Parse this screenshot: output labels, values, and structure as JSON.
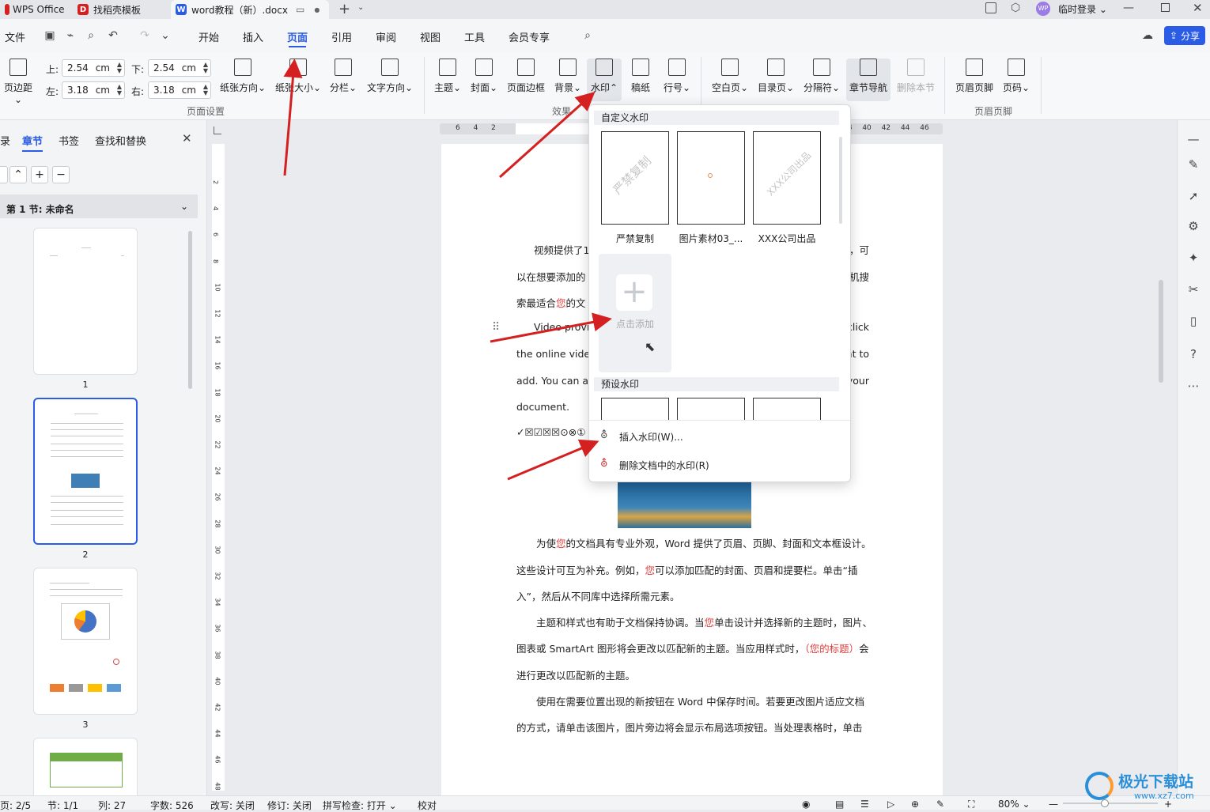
{
  "titlebar": {
    "tabs": [
      {
        "label": "WPS Office"
      },
      {
        "label": "找稻壳模板"
      },
      {
        "label": "word教程（新）.docx"
      }
    ],
    "user": "临时登录"
  },
  "menubar": {
    "file": "文件",
    "items": [
      "开始",
      "插入",
      "页面",
      "引用",
      "审阅",
      "视图",
      "工具",
      "会员专享"
    ],
    "active": "页面",
    "share": "分享"
  },
  "ribbon": {
    "margins_label": "页边距",
    "top_label": "上:",
    "top_value": "2.54",
    "bottom_label": "下:",
    "bottom_value": "2.54",
    "left_label": "左:",
    "left_value": "3.18",
    "right_label": "右:",
    "right_value": "3.18",
    "unit": "cm",
    "orientation": "纸张方向",
    "size": "纸张大小",
    "columns": "分栏",
    "text_direction": "文字方向",
    "page_setup_group": "页面设置",
    "theme": "主题",
    "cover": "封面",
    "page_border": "页面边框",
    "background": "背景",
    "watermark": "水印",
    "manuscript": "稿纸",
    "line_number": "行号",
    "effects_group": "效果",
    "blank_page": "空白页",
    "toc_page": "目录页",
    "separator": "分隔符",
    "section_nav": "章节导航",
    "delete_section": "删除本节",
    "header_footer": "页眉页脚",
    "page_number": "页码",
    "header_footer_group": "页眉页脚"
  },
  "leftpanel": {
    "tabs": [
      "录",
      "章节",
      "书签",
      "查找和替换"
    ],
    "active": "章节",
    "section": "第 1 节: 未命名",
    "pages": [
      "1",
      "2",
      "3"
    ]
  },
  "document": {
    "lines": [
      {
        "segments": [
          {
            "t": "视频提供了1"
          }
        ],
        "tail": "，可"
      },
      {
        "segments": [
          {
            "t": "以在想要添加的"
          }
        ],
        "tail": "机搜"
      },
      {
        "segments": [
          {
            "t": "索最适合"
          },
          {
            "t": "您",
            "red": true
          },
          {
            "t": "的文"
          }
        ],
        "tail": ""
      },
      {
        "segments": [
          {
            "t": "Video provid"
          }
        ],
        "tail": "click"
      },
      {
        "segments": [
          {
            "t": "the online video,"
          }
        ],
        "tail": "nt to"
      },
      {
        "segments": [
          {
            "t": "add. You can als"
          }
        ],
        "tail": "your"
      },
      {
        "segments": [
          {
            "t": "document."
          }
        ],
        "tail": ""
      },
      {
        "segments": [
          {
            "t": "✓☒☑☒☒⊙⊗①"
          }
        ],
        "tail": ""
      }
    ],
    "paragraphs": [
      [
        {
          "t": "　　为使"
        },
        {
          "t": "您",
          "red": true
        },
        {
          "t": "的文档具有专业外观，Word 提供了页眉、页脚、封面和文本框设计。"
        }
      ],
      [
        {
          "t": "这些设计可互为补充。例如，"
        },
        {
          "t": "您",
          "red": true
        },
        {
          "t": "可以添加匹配的封面、页眉和提要栏。单击“插"
        }
      ],
      [
        {
          "t": "入”，然后从不同库中选择所需元素。"
        }
      ],
      [
        {
          "t": "　　主题和样式也有助于文档保持协调。当"
        },
        {
          "t": "您",
          "red": true
        },
        {
          "t": "单击设计并选择新的主题时，图片、"
        }
      ],
      [
        {
          "t": "图表或 SmartArt 图形将会更改以匹配新的主题。当应用样式时，"
        },
        {
          "t": "（您的标题）",
          "red": true
        },
        {
          "t": "会"
        }
      ],
      [
        {
          "t": "进行更改以匹配新的主题。"
        }
      ],
      [
        {
          "t": "　　使用在需要位置出现的新按钮在 Word 中保存时间。若要更改图片适应文档"
        }
      ],
      [
        {
          "t": "的方式，请单击该图片，图片旁边将会显示布局选项按钮。当处理表格时，单击"
        }
      ]
    ]
  },
  "dropdown": {
    "custom_header": "自定义水印",
    "cards": [
      {
        "label": "严禁复制",
        "text": "严禁复制"
      },
      {
        "label": "图片素材03_...",
        "text": ""
      },
      {
        "label": "XXX公司出品",
        "text": "XXX公司出品"
      }
    ],
    "add_label": "点击添加",
    "preset_header": "预设水印",
    "insert": "插入水印(W)...",
    "delete": "删除文档中的水印(R)"
  },
  "statusbar": {
    "page": "页: 2/5",
    "section": "节: 1/1",
    "column": "列: 27",
    "words": "字数: 526",
    "rewrite": "改写: 关闭",
    "revision": "修订: 关闭",
    "spell": "拼写检查: 打开",
    "proof": "校对",
    "zoom": "80%"
  },
  "watermark_brand": "极光下载站",
  "watermark_url": "www.xz7.com",
  "colors": {
    "accent": "#2b5ce6",
    "arrow": "#d42020",
    "red_text": "#e03b3b"
  }
}
